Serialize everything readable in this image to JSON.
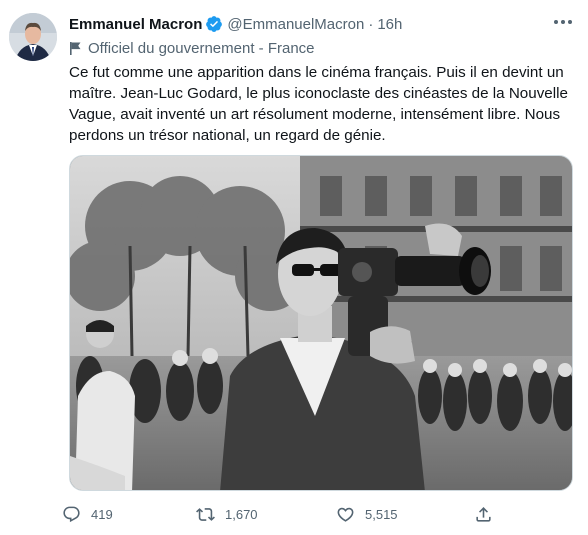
{
  "tweet": {
    "author_name": "Emmanuel Macron",
    "handle": "@EmmanuelMacron",
    "separator": "·",
    "time": "16h",
    "label": "Officiel du gouvernement - France",
    "text": "Ce fut comme une apparition dans le cinéma français. Puis il en devint un maître. Jean-Luc Godard, le plus iconoclaste des cinéastes de la Nouvelle Vague, avait inventé un art résolument moderne, intensément libre. Nous perdons un trésor national, un regard de génie."
  },
  "actions": {
    "replies": "419",
    "retweets": "1,670",
    "likes": "5,515"
  },
  "icons": {
    "verified": "verified-badge-icon",
    "more": "more-icon",
    "label": "flag-icon",
    "reply": "reply-icon",
    "retweet": "retweet-icon",
    "like": "heart-icon",
    "share": "share-icon"
  },
  "colors": {
    "verified": "#1d9bf0",
    "secondary_text": "#536471",
    "primary_text": "#0f1419"
  }
}
